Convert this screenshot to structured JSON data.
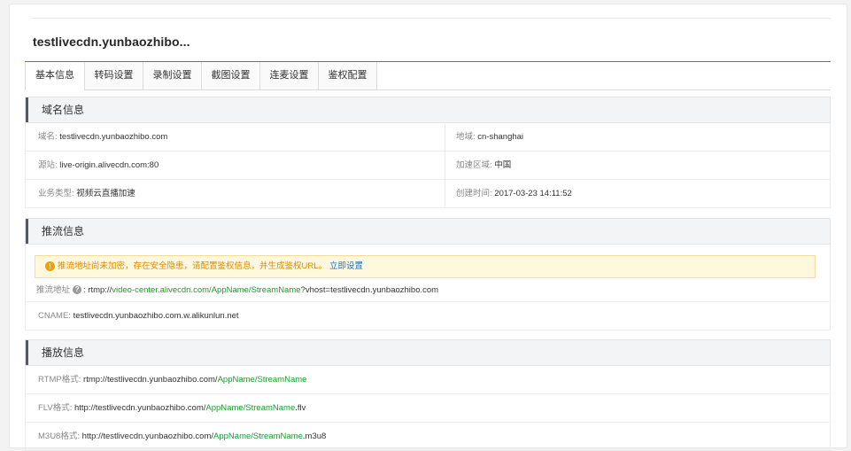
{
  "header": {
    "title": "testlivecdn.yunbaozhibo..."
  },
  "tabs": [
    {
      "label": "基本信息",
      "active": true
    },
    {
      "label": "转码设置"
    },
    {
      "label": "录制设置"
    },
    {
      "label": "截图设置"
    },
    {
      "label": "连麦设置"
    },
    {
      "label": "鉴权配置"
    }
  ],
  "domain_info": {
    "title": "域名信息",
    "domain_label": "域名:",
    "domain_value": "testlivecdn.yunbaozhibo.com",
    "region_label": "地域:",
    "region_value": "cn-shanghai",
    "origin_label": "源站:",
    "origin_value": "live-origin.alivecdn.com:80",
    "accel_label": "加速区域:",
    "accel_value": "中国",
    "biztype_label": "业务类型:",
    "biztype_value": "视频云直播加速",
    "created_label": "创建时间:",
    "created_value": "2017-03-23 14:11:52"
  },
  "push_info": {
    "title": "推流信息",
    "warning_icon": "exclamation-circle-icon",
    "warning_text": "推流地址尚未加密，存在安全隐患，请配置鉴权信息，并生成鉴权URL。",
    "warning_link": "立即设置",
    "address_label": "推流地址",
    "help_icon": "question-circle-icon",
    "address_sep": ": rtmp://",
    "address_host": "video-center.alivecdn.com/AppName/StreamName",
    "address_query": "?vhost=testlivecdn.yunbaozhibo.com",
    "cname_label": "CNAME:",
    "cname_value": "testlivecdn.yunbaozhibo.com.w.alikunlun.net"
  },
  "play_info": {
    "title": "播放信息",
    "rtmp_label": "RTMP格式:",
    "rtmp_prefix": "rtmp://testlivecdn.yunbaozhibo.com/",
    "rtmp_path": "AppName/StreamName",
    "flv_label": "FLV格式:",
    "flv_prefix": "http://testlivecdn.yunbaozhibo.com/",
    "flv_path": "AppName/StreamName",
    "flv_suffix": ".flv",
    "m3u8_label": "M3U8格式:",
    "m3u8_prefix": "http://testlivecdn.yunbaozhibo.com/",
    "m3u8_path": "AppName/StreamName",
    "m3u8_suffix": ".m3u8"
  },
  "colors": {
    "accent": "#0a8fd9",
    "link_green": "#1a9b2b",
    "warning": "#e08a00"
  }
}
